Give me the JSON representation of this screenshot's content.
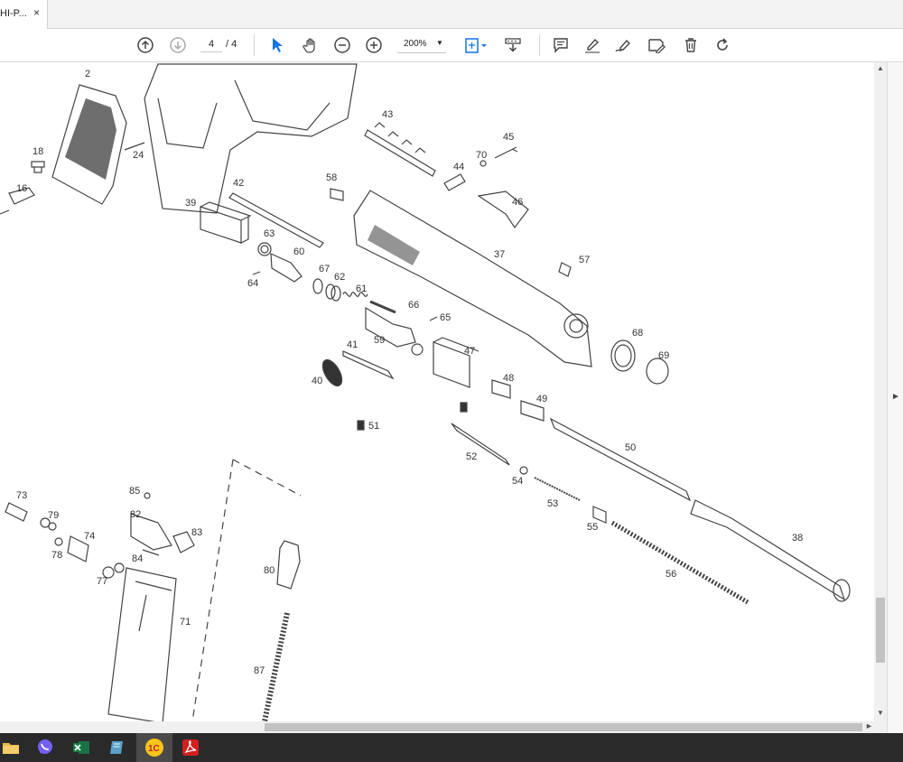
{
  "tab": {
    "title": "HI-P...",
    "close": "×"
  },
  "toolbar": {
    "page_current": "4",
    "page_total": "/ 4",
    "zoom": "200%",
    "zoom_caret": "▼"
  },
  "diagram": {
    "labels": [
      "2",
      "18",
      "16",
      "24",
      "39",
      "42",
      "63",
      "60",
      "64",
      "67",
      "62",
      "61",
      "66",
      "65",
      "59",
      "58",
      "43",
      "44",
      "70",
      "45",
      "46",
      "37",
      "57",
      "41",
      "40",
      "47",
      "48",
      "51",
      "49",
      "68",
      "69",
      "50",
      "52",
      "54",
      "53",
      "55",
      "56",
      "38",
      "73",
      "79",
      "78",
      "74",
      "77",
      "85",
      "82",
      "84",
      "83",
      "71",
      "80",
      "87"
    ]
  },
  "scroll": {
    "up": "▲",
    "down": "▼",
    "right": "►",
    "rail": "►"
  },
  "taskbar": {
    "items": [
      "file-explorer",
      "viber",
      "excel",
      "notes",
      "1c",
      "acrobat"
    ],
    "colors": {
      "explorer": "#e8b84a",
      "viber": "#7360f2",
      "excel": "#1e7145",
      "notes": "#5aa0c8",
      "onec": "#f5c518",
      "acrobat": "#d31f1f"
    }
  }
}
